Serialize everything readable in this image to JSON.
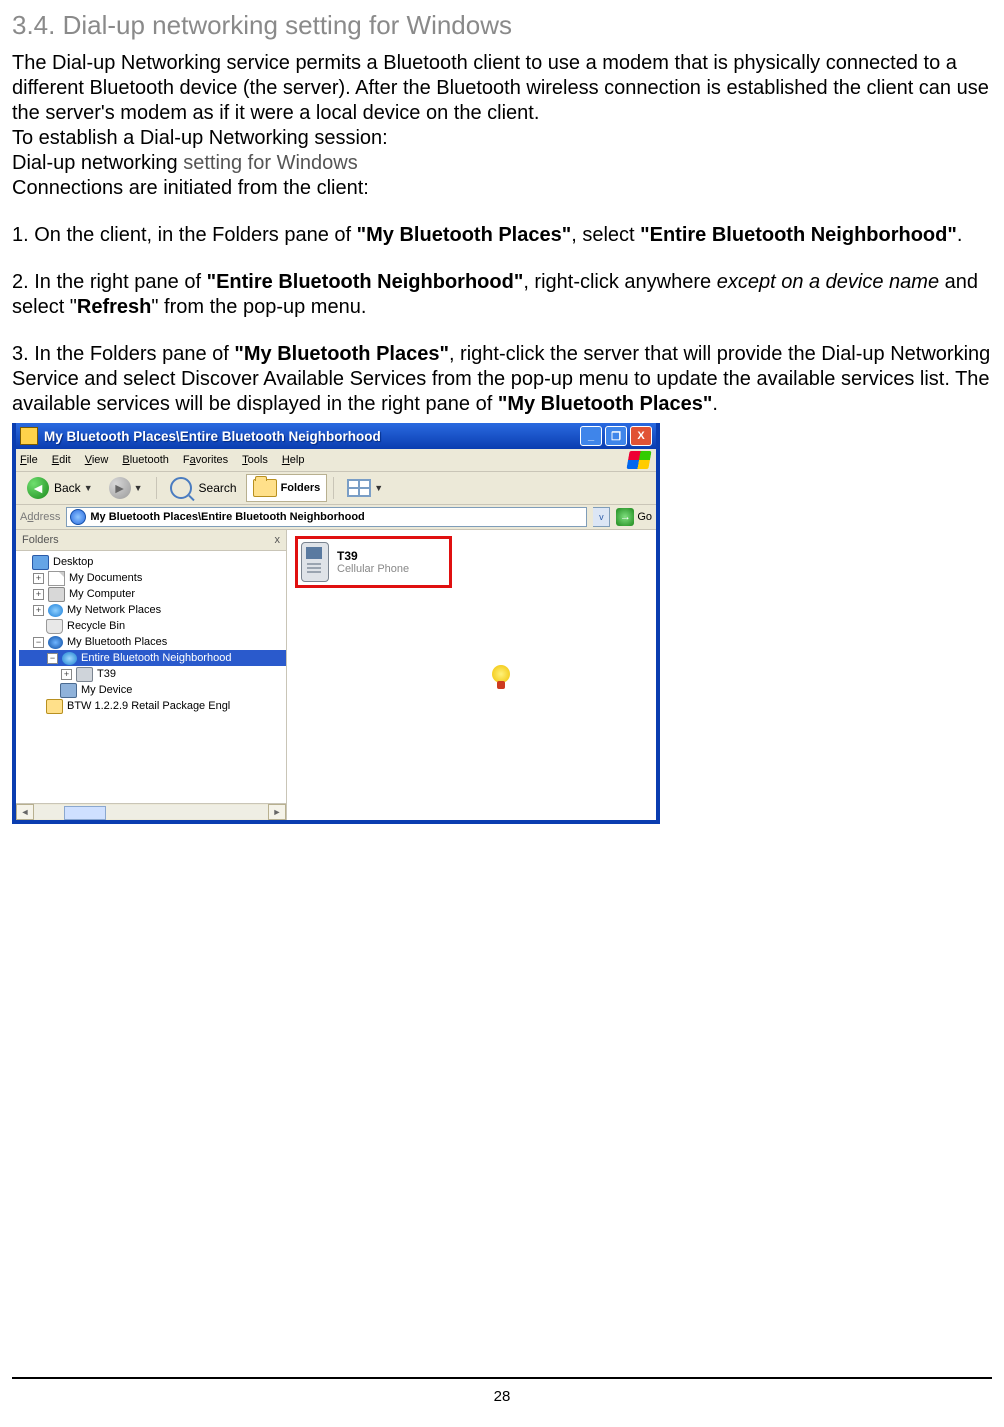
{
  "heading": "3.4. Dial-up networking setting for Windows",
  "para_intro_a": "The Dial-up Networking service permits a Bluetooth client to use a modem that is physically connected to a different Bluetooth device (the server). After the Bluetooth wireless connection is established the client can use the server's modem as if it were a local device on the client.",
  "para_intro_b": "To establish a Dial-up Networking session:",
  "para_intro_c_pre": "Dial-up networking ",
  "para_intro_c_grey": "setting for Windows",
  "para_intro_d": "Connections are initiated from the client:",
  "step1_a": "1. On the client, in the Folders pane of ",
  "step1_b": "\"My Bluetooth Places\"",
  "step1_c": ", select ",
  "step1_d": "\"Entire Bluetooth Neighborhood\"",
  "step1_e": ".",
  "step2_a": "2. In the right pane of ",
  "step2_b": "\"Entire Bluetooth Neighborhood\"",
  "step2_c": ", right-click anywhere ",
  "step2_d": "except on a device name",
  "step2_e": " and select \"",
  "step2_f": "Refresh",
  "step2_g": "\" from the pop-up menu.",
  "step3_a": "3. In the Folders pane of ",
  "step3_b": "\"My Bluetooth Places\"",
  "step3_c": ", right-click the server that will provide the Dial-up Networking Service and select Discover Available Services from the pop-up menu to update the available services list. The available services will be displayed in the right pane of ",
  "step3_d": "\"My Bluetooth Places\"",
  "step3_e": ".",
  "page_number": "28",
  "window": {
    "title": "My Bluetooth Places\\Entire Bluetooth Neighborhood",
    "menus": {
      "file": "File",
      "edit": "Edit",
      "view": "View",
      "bluetooth": "Bluetooth",
      "favorites": "Favorites",
      "tools": "Tools",
      "help": "Help"
    },
    "toolbar": {
      "back": "Back",
      "search": "Search",
      "folders": "Folders"
    },
    "address_label": "Address",
    "address_value": "My Bluetooth Places\\Entire Bluetooth Neighborhood",
    "go": "Go",
    "folders_header": "Folders",
    "folders_close": "x",
    "tree": {
      "desktop": "Desktop",
      "mydocs": "My Documents",
      "mycomp": "My Computer",
      "mynet": "My Network Places",
      "recycle": "Recycle Bin",
      "btplaces": "My Bluetooth Places",
      "btneigh": "Entire Bluetooth Neighborhood",
      "t39": "T39",
      "mydevice": "My Device",
      "btw": "BTW 1.2.2.9 Retail Package Engl"
    },
    "device": {
      "name": "T39",
      "type": "Cellular Phone"
    }
  }
}
